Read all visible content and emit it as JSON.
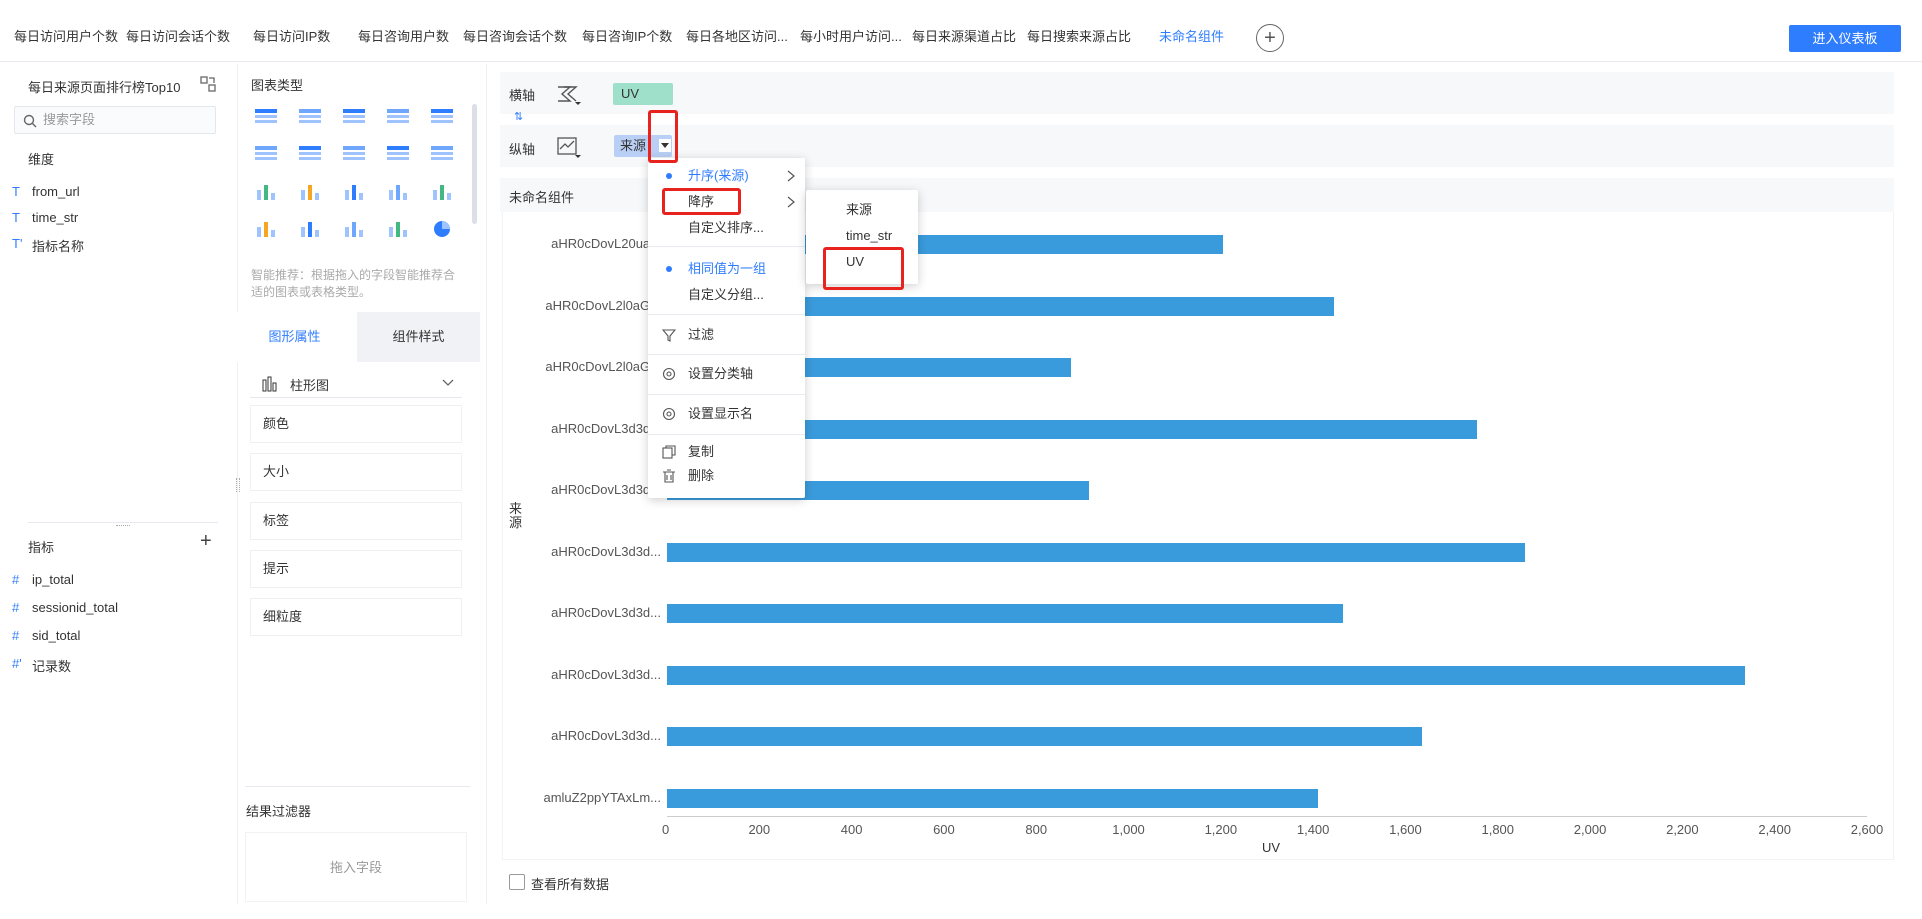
{
  "tabs": [
    {
      "label": "每日访问用户个数"
    },
    {
      "label": "每日访问会话个数"
    },
    {
      "label": "每日访问IP数"
    },
    {
      "label": "每日咨询用户数"
    },
    {
      "label": "每日咨询会话个数"
    },
    {
      "label": "每日咨询IP个数"
    },
    {
      "label": "每日各地区访问..."
    },
    {
      "label": "每小时用户访问..."
    },
    {
      "label": "每日来源渠道占比"
    },
    {
      "label": "每日搜索来源占比"
    },
    {
      "label": "未命名组件"
    }
  ],
  "add_tab_icon": "+",
  "dashboard_button": "进入仪表板",
  "left": {
    "dataset_title": "每日来源页面排行榜Top10",
    "search_placeholder": "搜索字段",
    "dim_title": "维度",
    "dims": [
      {
        "icon": "T",
        "name": "from_url"
      },
      {
        "icon": "T",
        "name": "time_str"
      },
      {
        "icon": "T'",
        "name": "指标名称"
      }
    ],
    "metric_title": "指标",
    "add_icon": "+",
    "metrics": [
      {
        "icon": "#",
        "name": "ip_total"
      },
      {
        "icon": "#",
        "name": "sessionid_total"
      },
      {
        "icon": "#",
        "name": "sid_total"
      },
      {
        "icon": "#'",
        "name": "记录数"
      }
    ]
  },
  "chart_types": {
    "title": "图表类型",
    "hint": "智能推荐：根据拖入的字段智能推荐合适的图表或表格类型。",
    "tab_graph": "图形属性",
    "tab_style": "组件样式",
    "selected_type": "柱形图",
    "props": [
      "颜色",
      "大小",
      "标签",
      "提示",
      "细粒度"
    ],
    "result_filter": "结果过滤器",
    "drag_field": "拖入字段"
  },
  "axes": {
    "x_label": "横轴",
    "x_field": "UV",
    "y_label": "纵轴",
    "y_field": "来源",
    "swap_icon": "⇅"
  },
  "component_title": "未命名组件",
  "context_menu": {
    "items": [
      {
        "label": "升序(来源)",
        "dot": true,
        "arrow": true
      },
      {
        "label": "降序",
        "dot": false,
        "arrow": true
      },
      {
        "label": "自定义排序...",
        "dot": false,
        "arrow": false
      },
      {
        "label": "相同值为一组",
        "dot": true,
        "arrow": false
      },
      {
        "label": "自定义分组...",
        "dot": false,
        "arrow": false
      },
      {
        "label": "过滤",
        "icon": "filter-icon"
      },
      {
        "label": "设置分类轴",
        "icon": "settings-icon"
      },
      {
        "label": "设置显示名",
        "icon": "settings-icon"
      },
      {
        "label": "复制",
        "icon": "copy-icon"
      },
      {
        "label": "删除",
        "icon": "trash-icon"
      }
    ],
    "submenu": [
      "来源",
      "time_str",
      "UV"
    ]
  },
  "chart_data": {
    "type": "bar",
    "orientation": "horizontal",
    "ylabel": "来源",
    "xlabel": "UV",
    "xlim": [
      0,
      2600
    ],
    "ticks": [
      "0",
      "200",
      "400",
      "600",
      "800",
      "1,000",
      "1,200",
      "1,400",
      "1,600",
      "1,800",
      "2,000",
      "2,200",
      "2,400",
      "2,600"
    ],
    "categories": [
      "aHR0cDovL20ua...",
      "aHR0cDovL2l0aG...",
      "aHR0cDovL2l0aG...",
      "aHR0cDovL3d3d...",
      "aHR0cDovL3d3d...",
      "aHR0cDovL3d3d...",
      "aHR0cDovL3d3d...",
      "aHR0cDovL3d3d...",
      "aHR0cDovL3d3d...",
      "amluZ2ppYTAxLm..."
    ],
    "values": [
      1205,
      1445,
      875,
      1755,
      915,
      1860,
      1465,
      2335,
      1635,
      1410
    ],
    "color": "#3a9bdc"
  },
  "view_all_data": "查看所有数据"
}
